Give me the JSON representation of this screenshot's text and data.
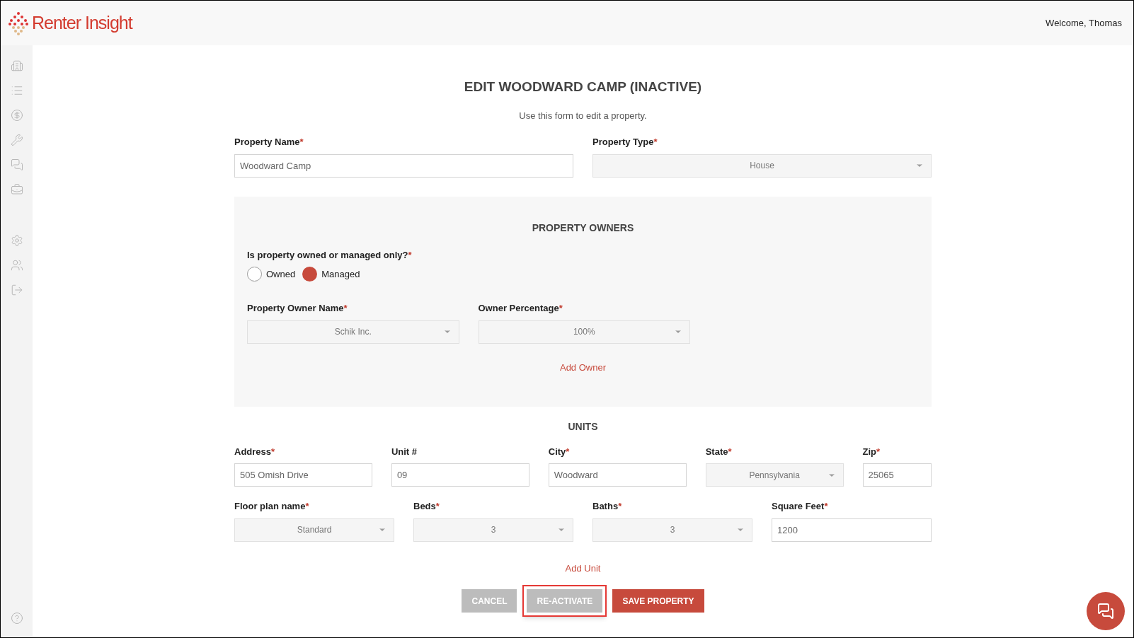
{
  "header": {
    "logo_text": "Renter Insight",
    "welcome": "Welcome, Thomas"
  },
  "sidebar": {
    "items": [
      {
        "kind": "building"
      },
      {
        "kind": "list"
      },
      {
        "kind": "dollar"
      },
      {
        "kind": "tools"
      },
      {
        "kind": "chat"
      },
      {
        "kind": "briefcase"
      },
      {
        "kind": "gap"
      },
      {
        "kind": "settings"
      },
      {
        "kind": "users"
      },
      {
        "kind": "logout"
      }
    ],
    "footer": {
      "kind": "help"
    }
  },
  "required_mark": "*",
  "form": {
    "title": "EDIT WOODWARD CAMP (INACTIVE)",
    "subtitle": "Use this form to edit a property.",
    "property_name": {
      "label": "Property Name",
      "required": true,
      "value": "Woodward Camp"
    },
    "property_type": {
      "label": "Property Type",
      "required": true,
      "value": "House"
    },
    "owners": {
      "heading": "PROPERTY OWNERS",
      "question": {
        "label": "Is property owned or managed only?",
        "required": true
      },
      "options": [
        {
          "label": "Owned",
          "selected": false
        },
        {
          "label": "Managed",
          "selected": true
        }
      ],
      "owner_name": {
        "label": "Property Owner Name",
        "required": true,
        "value": "Schik Inc."
      },
      "owner_percentage": {
        "label": "Owner Percentage",
        "required": true,
        "value": "100%"
      },
      "add_link": "Add Owner"
    },
    "units": {
      "heading": "UNITS",
      "rows": [
        [
          {
            "kind": "text",
            "label": "Address",
            "required": true,
            "value": "505 Omish Drive"
          },
          {
            "kind": "text",
            "label": "Unit #",
            "required": false,
            "value": "09"
          },
          {
            "kind": "text",
            "label": "City",
            "required": true,
            "value": "Woodward"
          },
          {
            "kind": "select",
            "label": "State",
            "required": true,
            "value": "Pennsylvania"
          },
          {
            "kind": "text",
            "label": "Zip",
            "required": true,
            "value": "25065"
          }
        ],
        [
          {
            "kind": "select",
            "label": "Floor plan name",
            "required": true,
            "value": "Standard"
          },
          {
            "kind": "select",
            "label": "Beds",
            "required": true,
            "value": "3"
          },
          {
            "kind": "select",
            "label": "Baths",
            "required": true,
            "value": "3"
          },
          {
            "kind": "text",
            "label": "Square Feet",
            "required": true,
            "value": "1200"
          }
        ]
      ],
      "add_link": "Add Unit"
    },
    "buttons": [
      {
        "label": "CANCEL",
        "kind": "secondary",
        "highlighted": false
      },
      {
        "label": "RE-ACTIVATE",
        "kind": "secondary",
        "highlighted": true
      },
      {
        "label": "SAVE PROPERTY",
        "kind": "primary",
        "highlighted": false
      }
    ]
  }
}
